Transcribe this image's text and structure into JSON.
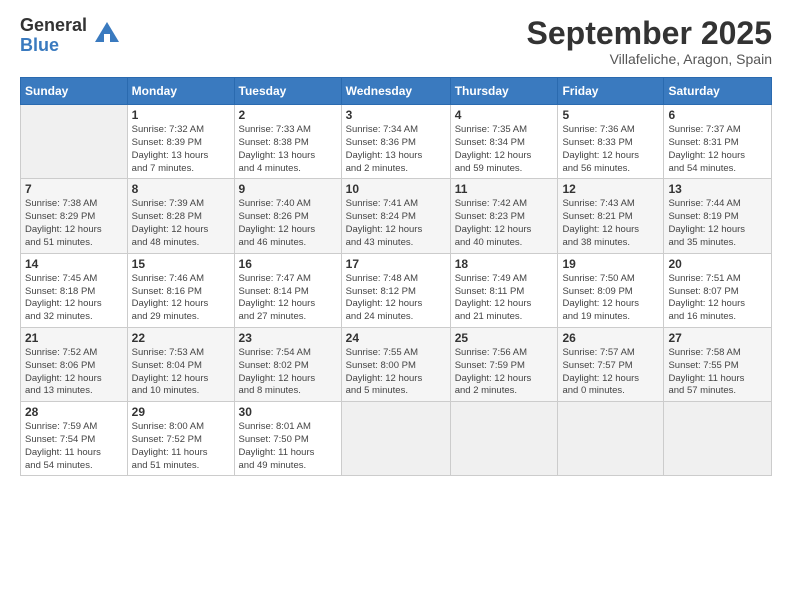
{
  "logo": {
    "general": "General",
    "blue": "Blue"
  },
  "header": {
    "month": "September 2025",
    "location": "Villafeliche, Aragon, Spain"
  },
  "weekdays": [
    "Sunday",
    "Monday",
    "Tuesday",
    "Wednesday",
    "Thursday",
    "Friday",
    "Saturday"
  ],
  "weeks": [
    [
      {
        "day": "",
        "info": ""
      },
      {
        "day": "1",
        "info": "Sunrise: 7:32 AM\nSunset: 8:39 PM\nDaylight: 13 hours\nand 7 minutes."
      },
      {
        "day": "2",
        "info": "Sunrise: 7:33 AM\nSunset: 8:38 PM\nDaylight: 13 hours\nand 4 minutes."
      },
      {
        "day": "3",
        "info": "Sunrise: 7:34 AM\nSunset: 8:36 PM\nDaylight: 13 hours\nand 2 minutes."
      },
      {
        "day": "4",
        "info": "Sunrise: 7:35 AM\nSunset: 8:34 PM\nDaylight: 12 hours\nand 59 minutes."
      },
      {
        "day": "5",
        "info": "Sunrise: 7:36 AM\nSunset: 8:33 PM\nDaylight: 12 hours\nand 56 minutes."
      },
      {
        "day": "6",
        "info": "Sunrise: 7:37 AM\nSunset: 8:31 PM\nDaylight: 12 hours\nand 54 minutes."
      }
    ],
    [
      {
        "day": "7",
        "info": "Sunrise: 7:38 AM\nSunset: 8:29 PM\nDaylight: 12 hours\nand 51 minutes."
      },
      {
        "day": "8",
        "info": "Sunrise: 7:39 AM\nSunset: 8:28 PM\nDaylight: 12 hours\nand 48 minutes."
      },
      {
        "day": "9",
        "info": "Sunrise: 7:40 AM\nSunset: 8:26 PM\nDaylight: 12 hours\nand 46 minutes."
      },
      {
        "day": "10",
        "info": "Sunrise: 7:41 AM\nSunset: 8:24 PM\nDaylight: 12 hours\nand 43 minutes."
      },
      {
        "day": "11",
        "info": "Sunrise: 7:42 AM\nSunset: 8:23 PM\nDaylight: 12 hours\nand 40 minutes."
      },
      {
        "day": "12",
        "info": "Sunrise: 7:43 AM\nSunset: 8:21 PM\nDaylight: 12 hours\nand 38 minutes."
      },
      {
        "day": "13",
        "info": "Sunrise: 7:44 AM\nSunset: 8:19 PM\nDaylight: 12 hours\nand 35 minutes."
      }
    ],
    [
      {
        "day": "14",
        "info": "Sunrise: 7:45 AM\nSunset: 8:18 PM\nDaylight: 12 hours\nand 32 minutes."
      },
      {
        "day": "15",
        "info": "Sunrise: 7:46 AM\nSunset: 8:16 PM\nDaylight: 12 hours\nand 29 minutes."
      },
      {
        "day": "16",
        "info": "Sunrise: 7:47 AM\nSunset: 8:14 PM\nDaylight: 12 hours\nand 27 minutes."
      },
      {
        "day": "17",
        "info": "Sunrise: 7:48 AM\nSunset: 8:12 PM\nDaylight: 12 hours\nand 24 minutes."
      },
      {
        "day": "18",
        "info": "Sunrise: 7:49 AM\nSunset: 8:11 PM\nDaylight: 12 hours\nand 21 minutes."
      },
      {
        "day": "19",
        "info": "Sunrise: 7:50 AM\nSunset: 8:09 PM\nDaylight: 12 hours\nand 19 minutes."
      },
      {
        "day": "20",
        "info": "Sunrise: 7:51 AM\nSunset: 8:07 PM\nDaylight: 12 hours\nand 16 minutes."
      }
    ],
    [
      {
        "day": "21",
        "info": "Sunrise: 7:52 AM\nSunset: 8:06 PM\nDaylight: 12 hours\nand 13 minutes."
      },
      {
        "day": "22",
        "info": "Sunrise: 7:53 AM\nSunset: 8:04 PM\nDaylight: 12 hours\nand 10 minutes."
      },
      {
        "day": "23",
        "info": "Sunrise: 7:54 AM\nSunset: 8:02 PM\nDaylight: 12 hours\nand 8 minutes."
      },
      {
        "day": "24",
        "info": "Sunrise: 7:55 AM\nSunset: 8:00 PM\nDaylight: 12 hours\nand 5 minutes."
      },
      {
        "day": "25",
        "info": "Sunrise: 7:56 AM\nSunset: 7:59 PM\nDaylight: 12 hours\nand 2 minutes."
      },
      {
        "day": "26",
        "info": "Sunrise: 7:57 AM\nSunset: 7:57 PM\nDaylight: 12 hours\nand 0 minutes."
      },
      {
        "day": "27",
        "info": "Sunrise: 7:58 AM\nSunset: 7:55 PM\nDaylight: 11 hours\nand 57 minutes."
      }
    ],
    [
      {
        "day": "28",
        "info": "Sunrise: 7:59 AM\nSunset: 7:54 PM\nDaylight: 11 hours\nand 54 minutes."
      },
      {
        "day": "29",
        "info": "Sunrise: 8:00 AM\nSunset: 7:52 PM\nDaylight: 11 hours\nand 51 minutes."
      },
      {
        "day": "30",
        "info": "Sunrise: 8:01 AM\nSunset: 7:50 PM\nDaylight: 11 hours\nand 49 minutes."
      },
      {
        "day": "",
        "info": ""
      },
      {
        "day": "",
        "info": ""
      },
      {
        "day": "",
        "info": ""
      },
      {
        "day": "",
        "info": ""
      }
    ]
  ]
}
